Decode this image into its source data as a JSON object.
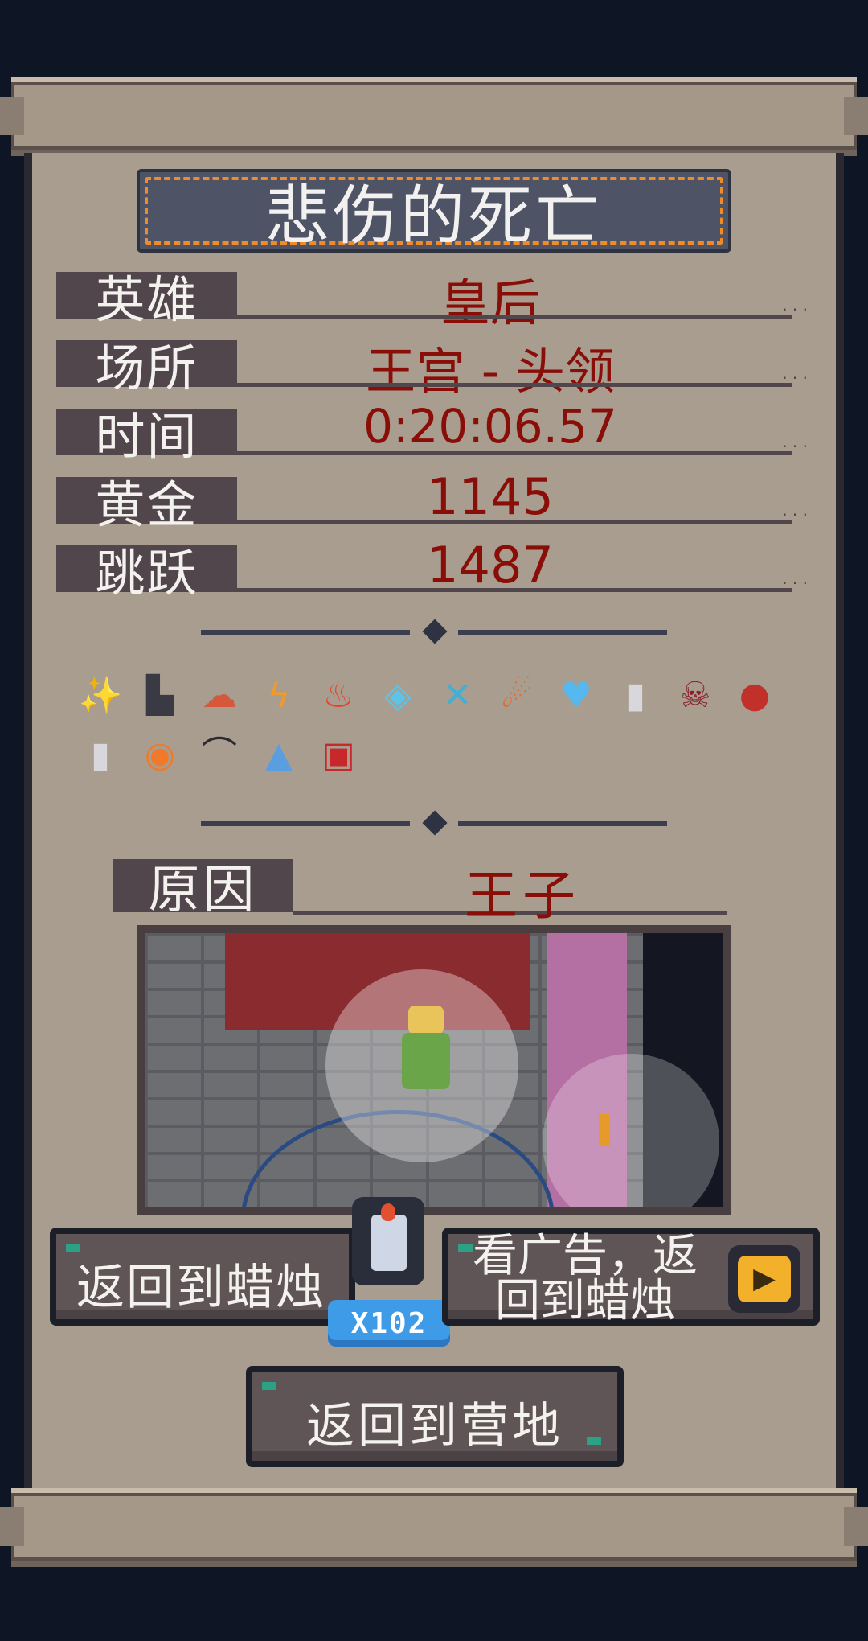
{
  "title": "悲伤的死亡",
  "stats": [
    {
      "label": "英雄",
      "value": "皇后"
    },
    {
      "label": "场所",
      "value": "王宫 - 头领"
    },
    {
      "label": "时间",
      "value": "0:20:06.57"
    },
    {
      "label": "黄金",
      "value": "1145"
    },
    {
      "label": "跳跃",
      "value": "1487"
    }
  ],
  "items": [
    {
      "icon": "sparkle-stars-icon",
      "glyph": "✨",
      "color": "#b48ad8"
    },
    {
      "icon": "boot-icon",
      "glyph": "▙",
      "color": "#3a3a44"
    },
    {
      "icon": "mushroom-cloud-icon",
      "glyph": "☁",
      "color": "#d6573a"
    },
    {
      "icon": "lightning-icon",
      "glyph": "ϟ",
      "color": "#f09a2c"
    },
    {
      "icon": "fire-icon",
      "glyph": "♨",
      "color": "#e8452a"
    },
    {
      "icon": "ice-cube-icon",
      "glyph": "◈",
      "color": "#5bc4e8"
    },
    {
      "icon": "ice-crossed-swords-icon",
      "glyph": "✕",
      "color": "#3fb0d8"
    },
    {
      "icon": "comet-icon",
      "glyph": "☄",
      "color": "#e56a2a"
    },
    {
      "icon": "blue-heart-icon",
      "glyph": "♥",
      "color": "#56b8ee"
    },
    {
      "icon": "jar-icon",
      "glyph": "▮",
      "color": "#d8d8dc"
    },
    {
      "icon": "skull-crate-icon",
      "glyph": "☠",
      "color": "#8a1f2a"
    },
    {
      "icon": "red-orb-icon",
      "glyph": "●",
      "color": "#c2302a"
    },
    {
      "icon": "jar-icon",
      "glyph": "▮",
      "color": "#d8d8dc"
    },
    {
      "icon": "fire-orb-icon",
      "glyph": "◉",
      "color": "#f07a2a"
    },
    {
      "icon": "boomerang-icon",
      "glyph": "⌒",
      "color": "#2a2a30"
    },
    {
      "icon": "ice-shards-icon",
      "glyph": "▲",
      "color": "#5a9ee0"
    },
    {
      "icon": "demon-card-icon",
      "glyph": "▣",
      "color": "#c8282a"
    }
  ],
  "reason": {
    "label": "原因",
    "value": "王子"
  },
  "buttons": {
    "return_candle": "返回到蜡烛",
    "watch_ad_line1": "看广告，返",
    "watch_ad_line2": "回到蜡烛",
    "return_camp": "返回到营地"
  },
  "candle_count": "X102",
  "colors": {
    "value_red": "#8a0e08",
    "label_bg": "#51464b",
    "paper": "#a99d90",
    "badge_blue": "#3e9be8",
    "title_border": "#f08b2a"
  }
}
